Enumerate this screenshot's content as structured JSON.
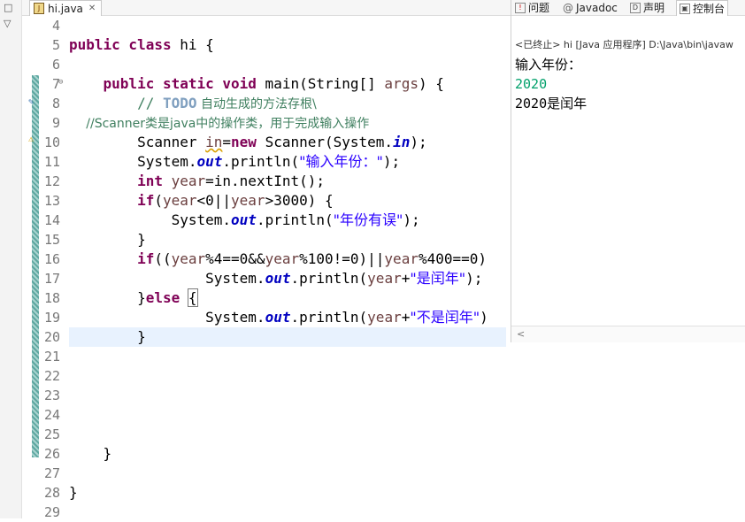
{
  "left_strip": {
    "restore_glyph": "□",
    "menu_glyph": "▽"
  },
  "editor": {
    "tab_title": "hi.java",
    "tab_close": "✕",
    "line_numbers": [
      "4",
      "5",
      "6",
      "7",
      "8",
      "9",
      "10",
      "11",
      "12",
      "13",
      "14",
      "15",
      "16",
      "17",
      "18",
      "19",
      "20",
      "21",
      "22",
      "23",
      "24",
      "25",
      "26",
      "27",
      "28",
      "29"
    ],
    "code": {
      "l5_kw": "public class",
      "l5_rest": " hi {",
      "l7_kw": "public static void",
      "l7_a": " main(String[] ",
      "l7_var": "args",
      "l7_b": ") {",
      "l8_a": "// ",
      "l8_todo": "TODO",
      "l8_b": " 自动生成的方法存根\\",
      "l9": "//Scanner类是java中的操作类，用于完成输入操作",
      "l10_a": "Scanner ",
      "l10_var": "in",
      "l10_eq": "=",
      "l10_kw": "new",
      "l10_b": " Scanner(System.",
      "l10_fld": "in",
      "l10_c": ");",
      "l11_a": "System.",
      "l11_fld": "out",
      "l11_b": ".println(",
      "l11_str": "\"输入年份：\"",
      "l11_c": ");",
      "l12_kw": "int",
      "l12_a": " ",
      "l12_var": "year",
      "l12_b": "=in.nextInt();",
      "l13_kw": "if",
      "l13_a": "(",
      "l13_v1": "year",
      "l13_b": "<0||",
      "l13_v2": "year",
      "l13_c": ">3000) {",
      "l14_a": "System.",
      "l14_fld": "out",
      "l14_b": ".println(",
      "l14_str": "\"年份有误\"",
      "l14_c": ");",
      "l15": "}",
      "l16_kw": "if",
      "l16_a": "((",
      "l16_v1": "year",
      "l16_b": "%4==0&&",
      "l16_v2": "year",
      "l16_c": "%100!=0)||",
      "l16_v3": "year",
      "l16_d": "%400==0)",
      "l17_a": "System.",
      "l17_fld": "out",
      "l17_b": ".println(",
      "l17_var": "year",
      "l17_c": "+",
      "l17_str": "\"是闰年\"",
      "l17_d": ");",
      "l18_a": "}",
      "l18_kw": "else",
      "l18_b": " ",
      "l18_brace": "{",
      "l19_a": "System.",
      "l19_fld": "out",
      "l19_b": ".println(",
      "l19_var": "year",
      "l19_c": "+",
      "l19_str": "\"不是闰年\"",
      "l19_d": ")",
      "l20": "}",
      "l26": "}",
      "l28": "}"
    }
  },
  "console": {
    "tabs": [
      {
        "label": "问题",
        "icon": "problems-icon"
      },
      {
        "label": "Javadoc",
        "icon": "javadoc-icon"
      },
      {
        "label": "声明",
        "icon": "declaration-icon"
      },
      {
        "label": "控制台",
        "icon": "console-icon"
      }
    ],
    "tab_glyphs": {
      "problems": "!",
      "javadoc": "@",
      "declaration": "D",
      "console": "▣"
    },
    "header": "<已终止> hi [Java 应用程序] D:\\Java\\bin\\javaw",
    "lines": [
      {
        "text": "输入年份：",
        "kind": "output"
      },
      {
        "text": "2020",
        "kind": "input"
      },
      {
        "text": "2020是闰年",
        "kind": "output"
      }
    ],
    "scroll_left": "<"
  }
}
